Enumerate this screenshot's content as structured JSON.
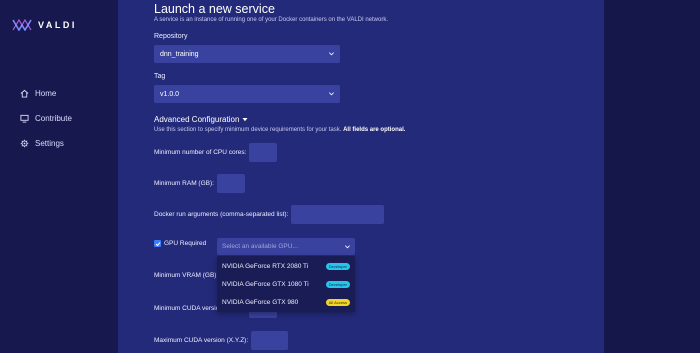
{
  "app": {
    "name": "VALDI"
  },
  "colors": {
    "sidebar": "#17184d",
    "main": "#242a7a",
    "input": "#3a42a0",
    "accent": "#3d7bff",
    "developer_badge": "#27c6e8",
    "all_access_badge": "#f2d52a"
  },
  "sidebar": {
    "items": [
      {
        "label": "Home",
        "icon": "home-icon"
      },
      {
        "label": "Contribute",
        "icon": "monitor-icon"
      },
      {
        "label": "Settings",
        "icon": "gear-icon"
      }
    ]
  },
  "page": {
    "title": "Launch a new service",
    "subtitle": "A service is an instance of running one of your Docker containers on the VALDI network."
  },
  "form": {
    "repository": {
      "label": "Repository",
      "value": "dnn_training"
    },
    "tag": {
      "label": "Tag",
      "value": "v1.0.0"
    },
    "advanced": {
      "heading": "Advanced Configuration",
      "description": "Use this section to specify minimum device requirements for your task.",
      "description_bold": "All fields are optional."
    },
    "cpu": {
      "label": "Minimum number of CPU cores:",
      "value": ""
    },
    "ram": {
      "label": "Minimum RAM (GB):",
      "value": ""
    },
    "docker_args": {
      "label": "Docker run arguments (comma-separated list):",
      "value": ""
    },
    "gpu_required": {
      "label": "GPU Required",
      "checked": true
    },
    "gpu_select": {
      "placeholder": "Select an available GPU...",
      "options": [
        {
          "label": "NVIDIA GeForce RTX 2080 Ti",
          "badge": "Developer"
        },
        {
          "label": "NVIDIA GeForce GTX 1080 Ti",
          "badge": "Developer"
        },
        {
          "label": "NVIDIA GeForce GTX 980",
          "badge": "All Access"
        }
      ]
    },
    "min_vram": {
      "label": "Minimum VRAM (GB):"
    },
    "min_cuda": {
      "label": "Minimum CUDA version (X.Y.Z):"
    },
    "max_cuda": {
      "label": "Maximum CUDA version (X.Y.Z):"
    }
  }
}
